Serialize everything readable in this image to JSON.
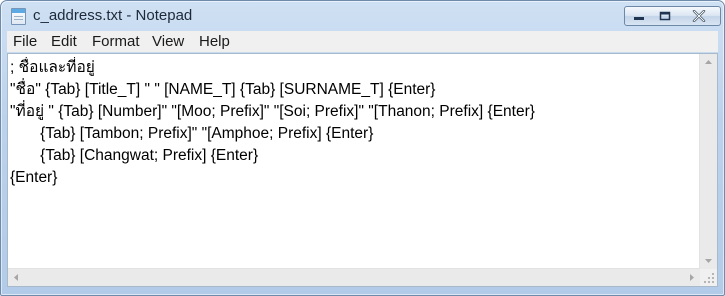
{
  "window": {
    "title": "c_address.txt - Notepad"
  },
  "menu": [
    "File",
    "Edit",
    "Format",
    "View",
    "Help"
  ],
  "document": {
    "lines": [
      "; ชื่อและที่อยู่",
      "\"ชื่อ\" {Tab} [Title_T] \" \" [NAME_T] {Tab} [SURNAME_T] {Enter}",
      "\"ที่อยู่ \" {Tab} [Number]\" \"[Moo; Prefix]\" \"[Soi; Prefix]\" \"[Thanon; Prefix] {Enter}",
      "       {Tab} [Tambon; Prefix]\" \"[Amphoe; Prefix] {Enter}",
      "       {Tab} [Changwat; Prefix] {Enter}",
      "{Enter}"
    ]
  },
  "icons": {
    "app": "notepad-icon",
    "minimize": "minimize-icon",
    "maximize": "maximize-icon",
    "close": "close-icon",
    "scroll_up": "scroll-up-arrow-icon",
    "scroll_down": "scroll-down-arrow-icon",
    "scroll_left": "scroll-left-arrow-icon",
    "scroll_right": "scroll-right-arrow-icon",
    "grip": "resize-grip-icon"
  }
}
